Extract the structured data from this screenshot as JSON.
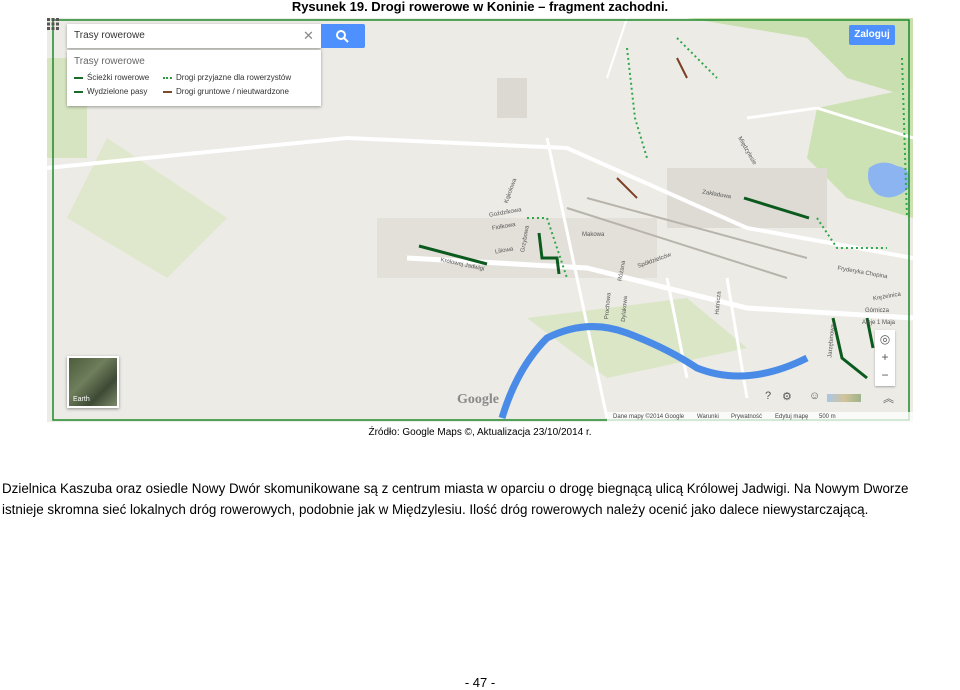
{
  "figure": {
    "title": "Rysunek 19. Drogi rowerowe w Koninie – fragment zachodni.",
    "source": "Źródło: Google Maps ©, Aktualizacja 23/10/2014 r."
  },
  "map": {
    "search_value": "Trasy rowerowe",
    "legend": {
      "header": "Trasy rowerowe",
      "items": [
        {
          "label": "Ścieżki rowerowe",
          "color": "#1a6b2a",
          "style": "solid"
        },
        {
          "label": "Wydzielone pasy",
          "color": "#1a6b2a",
          "style": "solid"
        },
        {
          "label": "Drogi przyjazne dla rowerzystów",
          "color": "#2e9b3a",
          "style": "dotted"
        },
        {
          "label": "Drogi gruntowe / nieutwardzone",
          "color": "#7a4a2a",
          "style": "solid"
        }
      ]
    },
    "login_label": "Zaloguj",
    "earth_label": "Earth",
    "logo": "Google",
    "street_labels": [
      "Kąkolowa",
      "Goździkowa",
      "Fiołkowa",
      "Liliowa",
      "Grzybowa",
      "Królowej Jadwigi",
      "Makowa",
      "Spółdzielców",
      "Różana",
      "Hutnicza",
      "Prochowa",
      "Dylakowa",
      "Międzylesie",
      "Zakładowa",
      "Fryderyka Chopina",
      "Krężelnica",
      "Górnicza",
      "Aleje 1 Maja",
      "Jarzębinowa"
    ],
    "footer": {
      "map_data": "Dane mapy ©2014 Google",
      "terms": "Warunki",
      "privacy": "Prywatność",
      "edit": "Edytuj mapę",
      "scale": "500 m"
    },
    "colors": {
      "bike_path": "#0b5a1e",
      "friendly": "#2fa84a",
      "unpaved": "#7a3f24",
      "river": "#4b8be8",
      "border": "#1c8a2a"
    }
  },
  "body": {
    "line1": "Dzielnica Kaszuba oraz osiedle Nowy Dwór skomunikowane są z centrum miasta w oparciu o drogę biegnącą ulicą Królowej Jadwigi. Na Nowym Dworze",
    "line2": "istnieje skromna sieć lokalnych dróg rowerowych, podobnie jak w Międzylesiu. Ilość dróg rowerowych należy ocenić jako dalece niewystarczającą."
  },
  "page_number": "- 47 -"
}
